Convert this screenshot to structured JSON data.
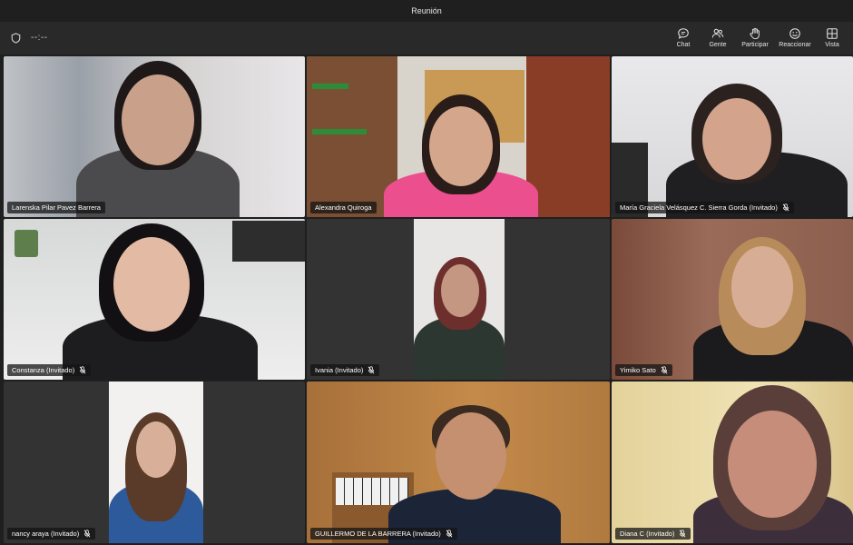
{
  "window": {
    "title": "Reunión"
  },
  "toolbar": {
    "timer": "--:--",
    "buttons": [
      {
        "label": "Chat",
        "icon": "chat-icon"
      },
      {
        "label": "Gente",
        "icon": "people-icon"
      },
      {
        "label": "Participar",
        "icon": "raise-hand-icon"
      },
      {
        "label": "Reaccionar",
        "icon": "emoji-icon"
      },
      {
        "label": "Vista",
        "icon": "grid-view-icon"
      }
    ]
  },
  "participants": [
    {
      "name": "Larenska Pilar Pavez Barrera",
      "muted": false
    },
    {
      "name": "Alexandra Quiroga",
      "muted": false
    },
    {
      "name": "María Graciela Velásquez C. Sierra Gorda (Invitado)",
      "muted": true
    },
    {
      "name": "Constanza (Invitado)",
      "muted": true
    },
    {
      "name": "Ivania (Invitado)",
      "muted": true
    },
    {
      "name": "Yimiko Sato",
      "muted": true
    },
    {
      "name": "nancy araya (Invitado)",
      "muted": true
    },
    {
      "name": "GUILLERMO DE LA BARRERA (Invitado)",
      "muted": true
    },
    {
      "name": "Diana C (Invitado)",
      "muted": true
    }
  ]
}
